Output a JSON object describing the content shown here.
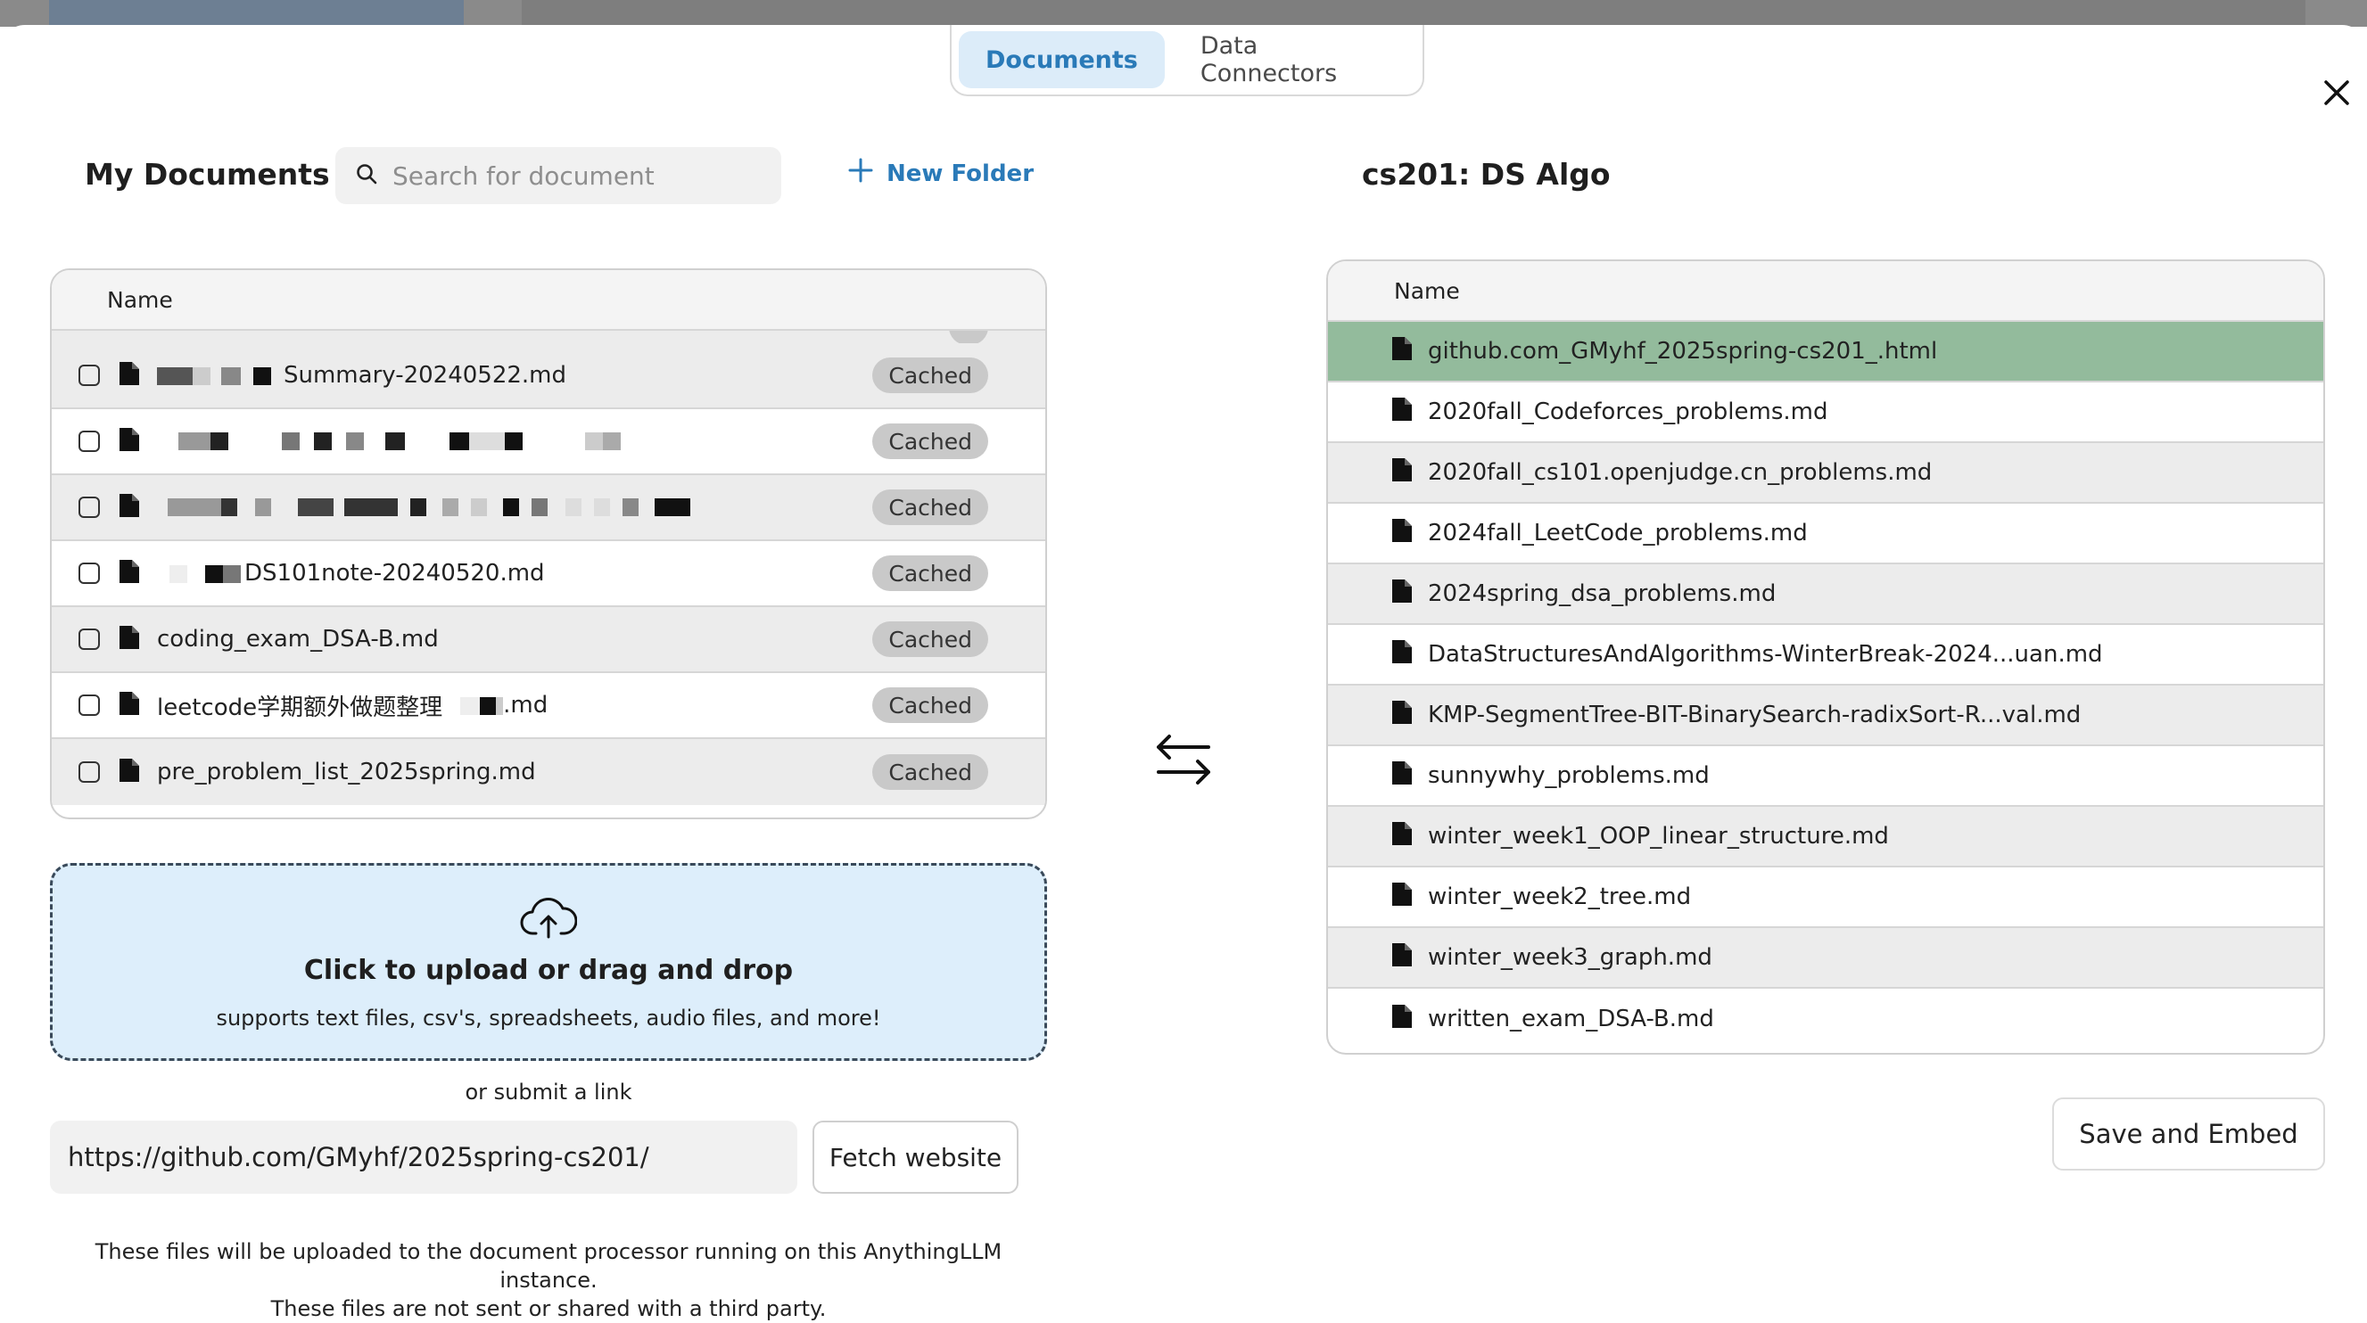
{
  "tabs": [
    {
      "label": "Documents",
      "active": true
    },
    {
      "label": "Data Connectors",
      "active": false
    }
  ],
  "left": {
    "title": "My Documents",
    "search_placeholder": "Search for document",
    "new_folder_label": "New Folder",
    "column_name": "Name",
    "rows": [
      {
        "name": "Summary-20240522.md",
        "status": "Cached"
      },
      {
        "name": "",
        "status": "Cached"
      },
      {
        "name": "",
        "status": "Cached"
      },
      {
        "name": "DS101note-20240520.md",
        "status": "Cached"
      },
      {
        "name": "coding_exam_DSA-B.md",
        "status": "Cached"
      },
      {
        "name": "leetcode学期额外做题整理",
        "name_suffix": ".md",
        "status": "Cached"
      },
      {
        "name": "pre_problem_list_2025spring.md",
        "status": "Cached"
      }
    ]
  },
  "upload": {
    "title": "Click to upload or drag and drop",
    "subtitle": "supports text files, csv's, spreadsheets, audio files, and more!",
    "or_link": "or submit a link",
    "url_value": "https://github.com/GMyhf/2025spring-cs201/",
    "fetch_label": "Fetch website",
    "note_line1": "These files will be uploaded to the document processor running on this AnythingLLM instance.",
    "note_line2": "These files are not sent or shared with a third party."
  },
  "right": {
    "title": "cs201: DS Algo",
    "column_name": "Name",
    "rows": [
      {
        "name": "github.com_GMyhf_2025spring-cs201_.html",
        "selected": true
      },
      {
        "name": "2020fall_Codeforces_problems.md"
      },
      {
        "name": "2020fall_cs101.openjudge.cn_problems.md"
      },
      {
        "name": "2024fall_LeetCode_problems.md"
      },
      {
        "name": "2024spring_dsa_problems.md"
      },
      {
        "name": "DataStructuresAndAlgorithms-WinterBreak-2024...uan.md"
      },
      {
        "name": "KMP-SegmentTree-BIT-BinarySearch-radixSort-R...val.md"
      },
      {
        "name": "sunnywhy_problems.md"
      },
      {
        "name": "winter_week1_OOP_linear_structure.md"
      },
      {
        "name": "winter_week2_tree.md"
      },
      {
        "name": "winter_week3_graph.md"
      },
      {
        "name": "written_exam_DSA-B.md"
      }
    ],
    "save_label": "Save and Embed"
  },
  "icons": {
    "search": "search-icon",
    "plus": "plus-icon",
    "file": "file-icon",
    "upload": "cloud-upload-icon",
    "swap": "swap-arrows-icon",
    "close": "close-icon"
  },
  "colors": {
    "accent": "#2a7ab8",
    "selected_row": "#93bb9c",
    "dropzone_bg": "#ddeefb"
  }
}
